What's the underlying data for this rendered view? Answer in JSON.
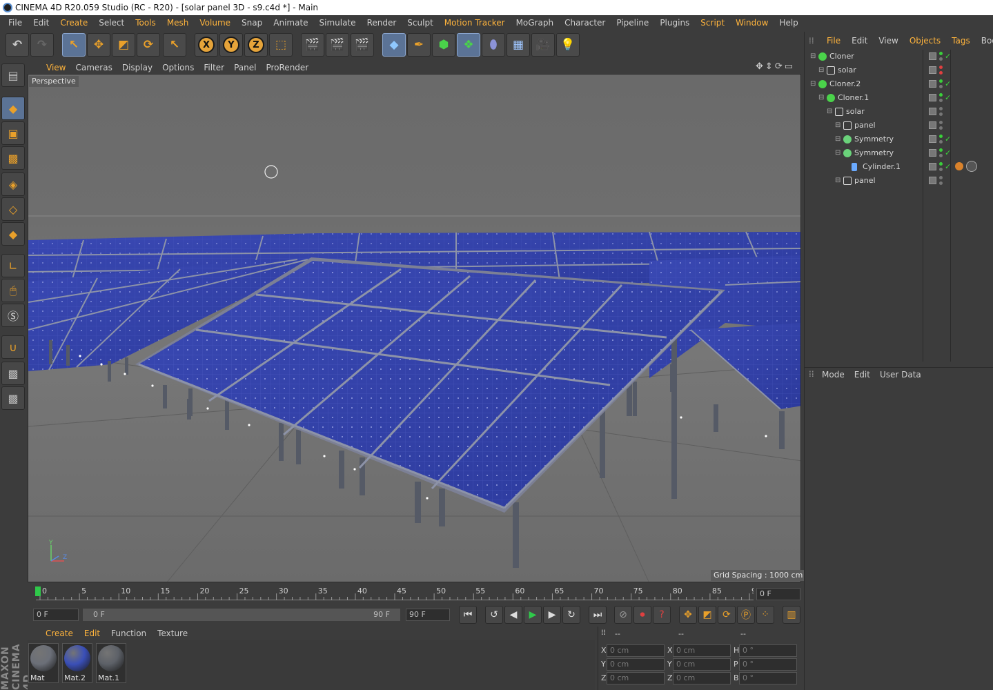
{
  "window": {
    "title": "CINEMA 4D R20.059 Studio (RC - R20) - [solar panel 3D - s9.c4d *] - Main"
  },
  "menubar": {
    "items": [
      {
        "label": "File"
      },
      {
        "label": "Edit"
      },
      {
        "label": "Create",
        "highlight": true
      },
      {
        "label": "Select"
      },
      {
        "label": "Tools",
        "highlight": true
      },
      {
        "label": "Mesh",
        "highlight": true
      },
      {
        "label": "Volume",
        "highlight": true
      },
      {
        "label": "Snap"
      },
      {
        "label": "Animate"
      },
      {
        "label": "Simulate"
      },
      {
        "label": "Render"
      },
      {
        "label": "Sculpt"
      },
      {
        "label": "Motion Tracker",
        "highlight": true
      },
      {
        "label": "MoGraph"
      },
      {
        "label": "Character"
      },
      {
        "label": "Pipeline"
      },
      {
        "label": "Plugins"
      },
      {
        "label": "Script",
        "highlight": true
      },
      {
        "label": "Window",
        "highlight": true
      },
      {
        "label": "Help"
      }
    ]
  },
  "viewport": {
    "menu": [
      {
        "label": "View",
        "highlight": true
      },
      {
        "label": "Cameras"
      },
      {
        "label": "Display"
      },
      {
        "label": "Options"
      },
      {
        "label": "Filter"
      },
      {
        "label": "Panel"
      },
      {
        "label": "ProRender"
      }
    ],
    "camera_label": "Perspective",
    "grid_spacing": "Grid Spacing : 1000 cm",
    "axis": {
      "x": "X",
      "y": "Y",
      "z": "Z"
    }
  },
  "timeline": {
    "ticks": [
      "0",
      "5",
      "10",
      "15",
      "20",
      "25",
      "30",
      "35",
      "40",
      "45",
      "50",
      "55",
      "60",
      "65",
      "70",
      "75",
      "80",
      "85",
      "90"
    ],
    "current_frame": "0 F",
    "start_field": "0 F",
    "range_start": "0 F",
    "range_end": "90 F",
    "end_field": "90 F"
  },
  "material_manager": {
    "menu": [
      {
        "label": "Create",
        "highlight": true
      },
      {
        "label": "Edit",
        "highlight": true
      },
      {
        "label": "Function"
      },
      {
        "label": "Texture"
      }
    ],
    "materials": [
      {
        "label": "Mat",
        "color": "#6b6f78"
      },
      {
        "label": "Mat.2",
        "color": "#3a4fb8"
      },
      {
        "label": "Mat.1",
        "color": "#5d6168"
      }
    ]
  },
  "coordinates": {
    "headers": [
      "--",
      "--",
      "--"
    ],
    "rows": [
      {
        "a": "X",
        "av": "0 cm",
        "b": "X",
        "bv": "0 cm",
        "c": "H",
        "cv": "0 °"
      },
      {
        "a": "Y",
        "av": "0 cm",
        "b": "Y",
        "bv": "0 cm",
        "c": "P",
        "cv": "0 °"
      },
      {
        "a": "Z",
        "av": "0 cm",
        "b": "Z",
        "bv": "0 cm",
        "c": "B",
        "cv": "0 °"
      }
    ]
  },
  "object_manager": {
    "menu": [
      {
        "label": "File",
        "highlight": true
      },
      {
        "label": "Edit"
      },
      {
        "label": "View"
      },
      {
        "label": "Objects",
        "highlight": true
      },
      {
        "label": "Tags",
        "highlight": true
      },
      {
        "label": "Bookmark"
      }
    ],
    "objects": [
      {
        "name": "Cloner",
        "icon": "cloner-icon",
        "depth": 0,
        "dot": "green"
      },
      {
        "name": "solar",
        "icon": "null-icon",
        "depth": 1,
        "dot": "red"
      },
      {
        "name": "Cloner.2",
        "icon": "cloner-icon",
        "depth": 0,
        "dot": "green"
      },
      {
        "name": "Cloner.1",
        "icon": "cloner-icon",
        "depth": 1,
        "dot": "green"
      },
      {
        "name": "solar",
        "icon": "null-icon",
        "depth": 2,
        "dot": "gray"
      },
      {
        "name": "panel",
        "icon": "null-icon",
        "depth": 3,
        "dot": "gray"
      },
      {
        "name": "Symmetry",
        "icon": "symmetry-icon",
        "depth": 3,
        "dot": "green"
      },
      {
        "name": "Symmetry",
        "icon": "symmetry-icon",
        "depth": 3,
        "dot": "green"
      },
      {
        "name": "Cylinder.1",
        "icon": "cylinder-icon",
        "depth": 4,
        "dot": "green"
      },
      {
        "name": "panel",
        "icon": "null-icon",
        "depth": 3,
        "dot": "gray"
      }
    ]
  },
  "attribute_manager": {
    "menu": [
      {
        "label": "Mode"
      },
      {
        "label": "Edit"
      },
      {
        "label": "User Data"
      }
    ]
  },
  "branding": {
    "text": "MAXON CINEMA 4D"
  },
  "colors": {
    "accent": "#ffb43c",
    "panel_blue": "#3443a6",
    "play_green": "#2fc94a"
  }
}
